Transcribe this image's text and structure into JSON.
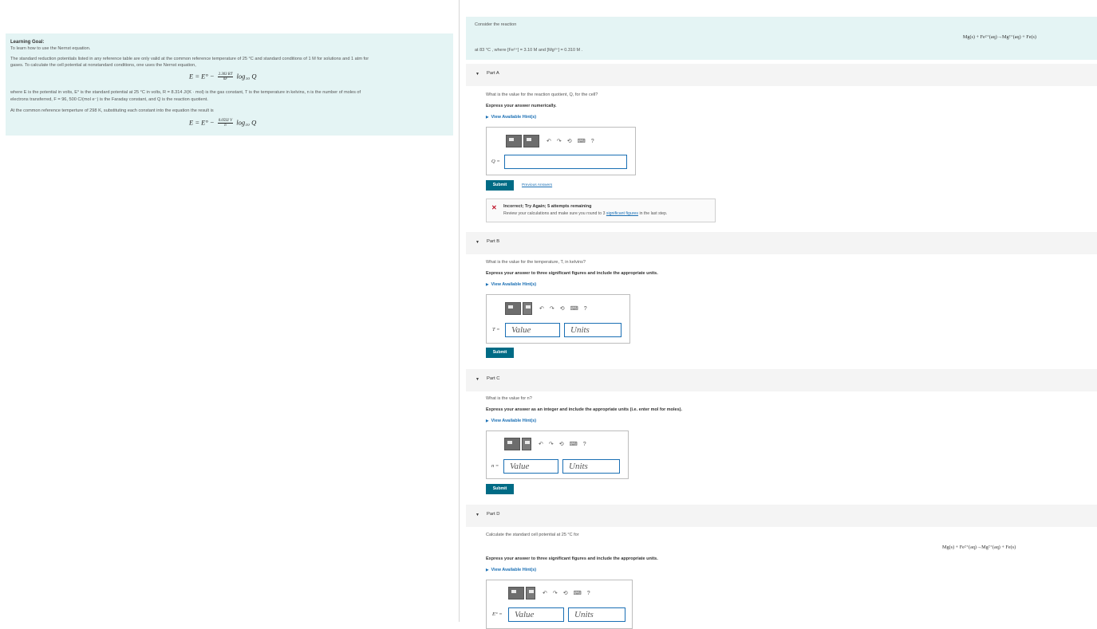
{
  "learning_goal": {
    "title": "Learning Goal:",
    "line1": "To learn how to use the Nernst equation.",
    "line2": "The standard reduction potentials listed in any reference table are only valid at the common reference temperature of 25 °C and standard conditions of 1 M for solutions and 1 atm for",
    "line3": "gases. To calculate the cell potential at nonstandard conditions, one uses the Nernst equation,",
    "eq1_lhs": "E = E° −",
    "eq1_num": "2.303 RT",
    "eq1_den": "nF",
    "eq1_rhs": "log₁₀ Q",
    "line4": "where E is the potential in volts, E° is the standard potential at 25 °C in volts, R = 8.314 J/(K · mol) is the gas constant, T is the temperature in kelvins, n is the number of moles of",
    "line5": "electrons transferred, F = 96, 500 C/(mol e⁻) is the Faraday constant, and Q is the reaction quotient.",
    "line6": "At the common reference temperture of 298 K, substituting each constant into the equation the result is",
    "eq2_lhs": "E = E° −",
    "eq2_num": "0.0592 V",
    "eq2_den": "n",
    "eq2_rhs": "log₁₀ Q"
  },
  "intro": {
    "consider": "Consider the reaction",
    "reaction": "Mg(s) + Fe²⁺(aq)→Mg²⁺(aq) + Fe(s)",
    "conditions": "at 83 °C , where [Fe²⁺] = 3.10 M and [Mg²⁺] = 0.310 M ."
  },
  "parts": {
    "a": {
      "label": "Part A",
      "question": "What is the value for the reaction quotient, Q, for the cell?",
      "instruction": "Express your answer numerically.",
      "hint": "View Available Hint(s)",
      "field_label": "Q =",
      "field_value": "",
      "submit": "Submit",
      "previous": "Previous Answers",
      "feedback_title": "Incorrect; Try Again; 5 attempts remaining",
      "feedback_text_pre": "Review your calculations and make sure you round to 3 ",
      "feedback_link": "significant figures",
      "feedback_text_post": " in the last step."
    },
    "b": {
      "label": "Part B",
      "question": "What is the value for the temperature, T, in kelvins?",
      "instruction": "Express your answer to three significant figures and include the appropriate units.",
      "hint": "View Available Hint(s)",
      "field_label": "T =",
      "value_placeholder": "Value",
      "units_placeholder": "Units",
      "submit": "Submit"
    },
    "c": {
      "label": "Part C",
      "question": "What is the value for n?",
      "instruction": "Express your answer as an integer and include the appropriate units (i.e. enter mol for moles).",
      "hint": "View Available Hint(s)",
      "field_label": "n =",
      "value_placeholder": "Value",
      "units_placeholder": "Units",
      "submit": "Submit"
    },
    "d": {
      "label": "Part D",
      "question": "Calculate the standard cell potential at 25 °C for",
      "reaction": "Mg(s) + Fe²⁺(aq)→Mg²⁺(aq) + Fe(s)",
      "instruction": "Express your answer to three significant figures and include the appropriate units.",
      "hint": "View Available Hint(s)",
      "field_label": "E° =",
      "value_placeholder": "Value",
      "units_placeholder": "Units"
    }
  },
  "toolbar_icons": [
    "undo-icon",
    "redo-icon",
    "reset-icon",
    "keyboard-icon",
    "help-icon"
  ],
  "toolbar_glyphs": {
    "undo": "↶",
    "redo": "↷",
    "reset": "⟲",
    "keyboard": "⌨",
    "help": "?"
  }
}
